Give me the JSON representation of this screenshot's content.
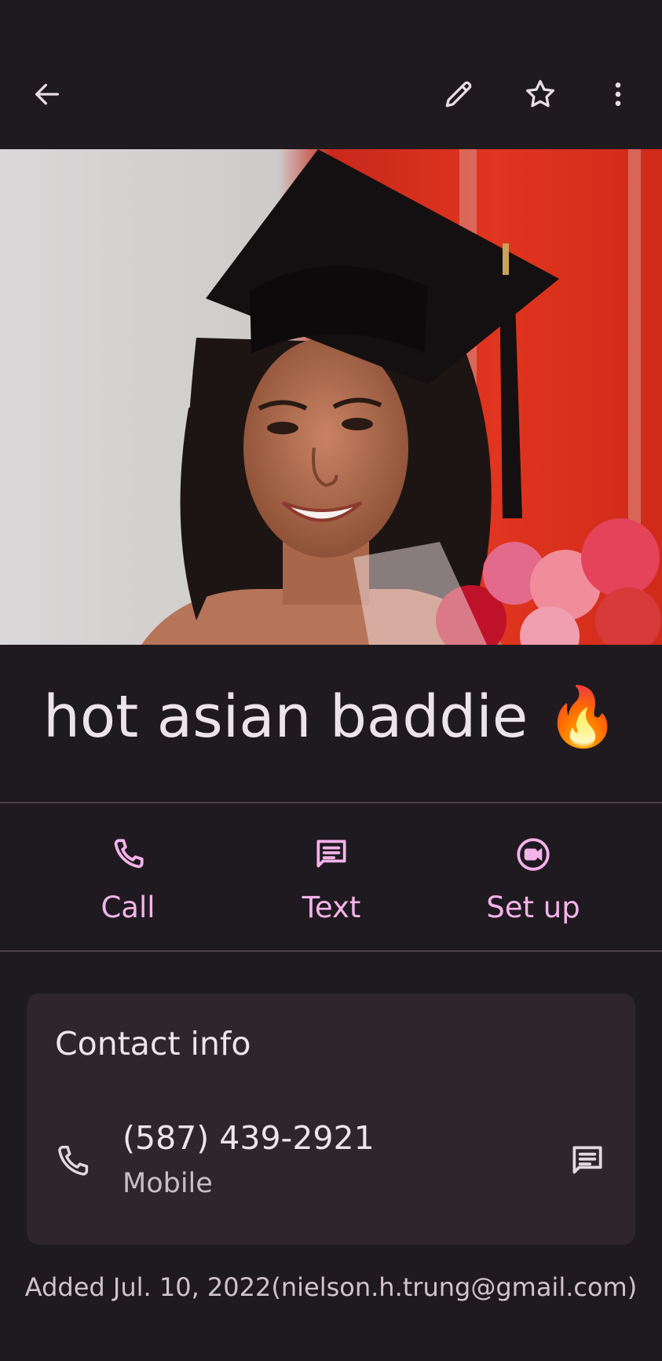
{
  "toolbar": {
    "back_icon": "arrow-left-icon",
    "edit_icon": "pencil-icon",
    "favorite_icon": "star-outline-icon",
    "more_icon": "more-vertical-icon"
  },
  "contact": {
    "name": "hot asian baddie 🔥",
    "photo_description_icon": "contact-photo"
  },
  "actions": [
    {
      "label": "Call",
      "icon": "phone-icon"
    },
    {
      "label": "Text",
      "icon": "message-icon"
    },
    {
      "label": "Set up",
      "icon": "video-call-icon"
    }
  ],
  "contact_info": {
    "title": "Contact info",
    "phone": {
      "number": "(587) 439-2921",
      "type": "Mobile"
    }
  },
  "footer": {
    "added": "Added Jul. 10, 2022(nielson.h.trung@gmail.com)"
  },
  "colors": {
    "background": "#1f1a1f",
    "accent": "#f5b3ea",
    "card": "#2e252d",
    "text": "#ece4ea"
  }
}
